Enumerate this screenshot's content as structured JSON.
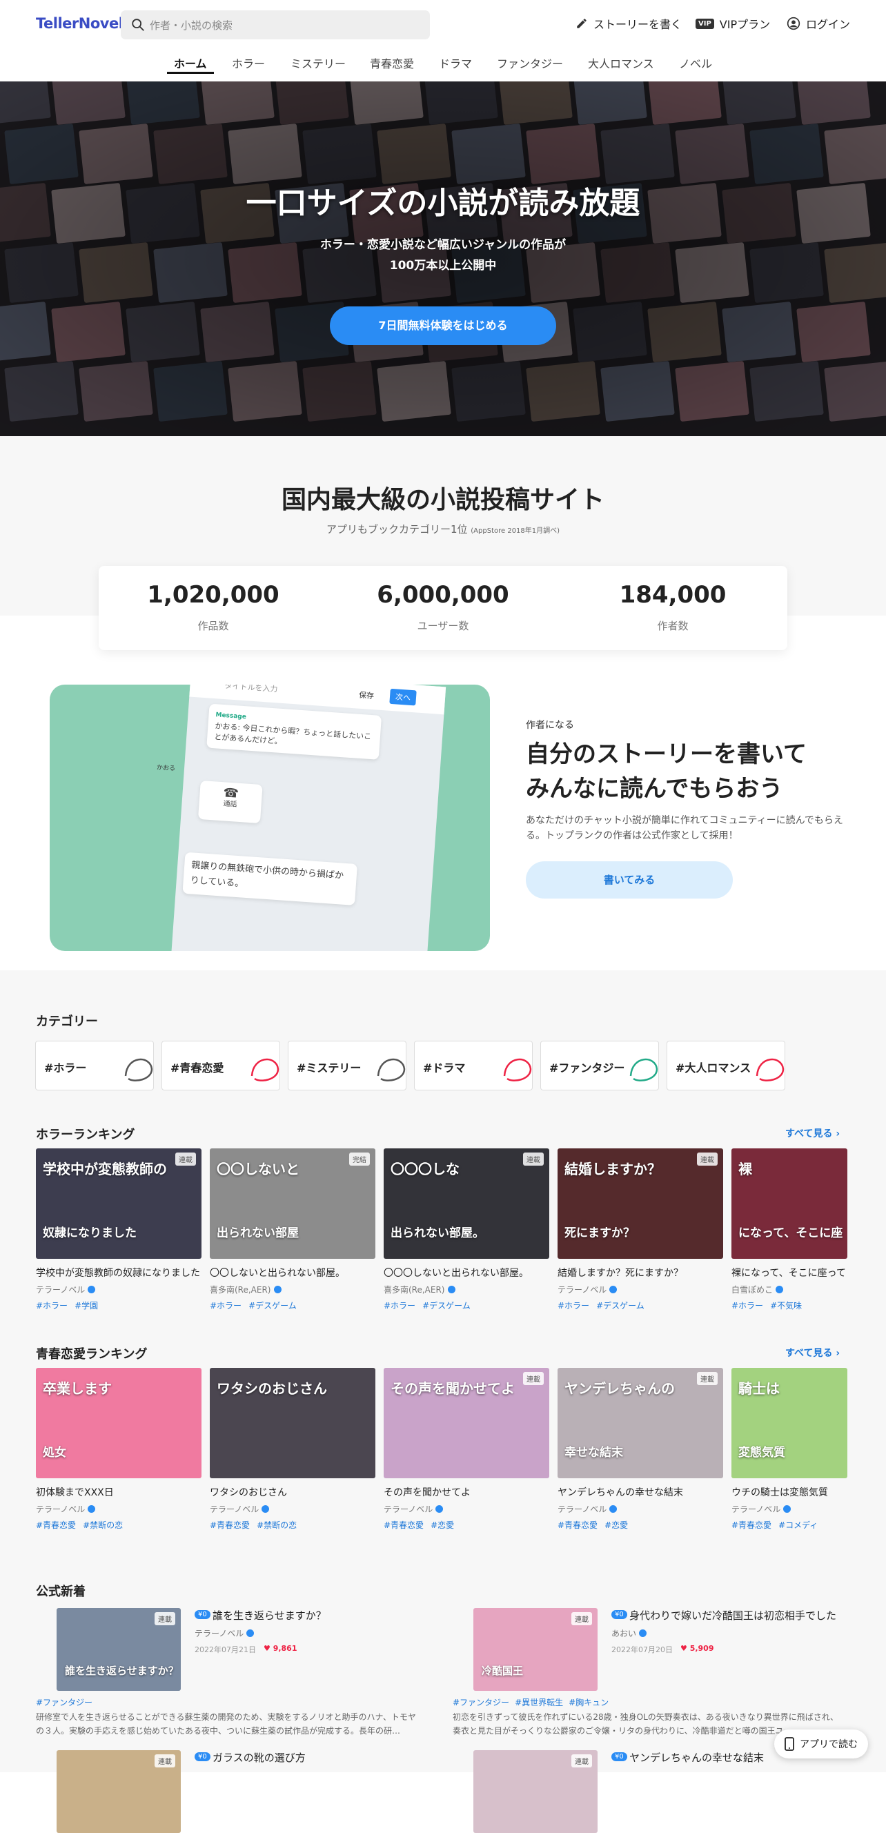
{
  "header": {
    "logo": "TellerNovel",
    "search_placeholder": "作者・小説の検索",
    "write_label": "ストーリーを書く",
    "vip_badge": "VIP",
    "vip_label": "VIPプラン",
    "login_label": "ログイン"
  },
  "nav": [
    "ホーム",
    "ホラー",
    "ミステリー",
    "青春恋愛",
    "ドラマ",
    "ファンタジー",
    "大人ロマンス",
    "ノベル"
  ],
  "hero": {
    "title": "一口サイズの小説が読み放題",
    "sub1": "ホラー・恋愛小説など幅広いジャンルの作品が",
    "sub2": "100万本以上公開中",
    "cta": "7日間無料体験をはじめる"
  },
  "stats": {
    "title": "国内最大級の小説投稿サイト",
    "subtitle": "アプリもブックカテゴリー1位",
    "subtitle_note": "(AppStore 2018年1月調べ)",
    "items": [
      {
        "num": "1,020,000",
        "label": "作品数"
      },
      {
        "num": "6,000,000",
        "label": "ユーザー数"
      },
      {
        "num": "184,000",
        "label": "作者数"
      }
    ]
  },
  "writer": {
    "tag": "作者になる",
    "heading1": "自分のストーリーを書いて",
    "heading2": "みんなに読んでもらおう",
    "desc": "あなただけのチャット小説が簡単に作れてコミュニティーに読んでもらえる。トップランクの作者は公式作家として採用！",
    "button": "書いてみる",
    "mock_title_ph": "タイトルを入力",
    "mock_save": "保存",
    "mock_next": "次へ",
    "mock_message_label": "Message",
    "mock_message": "かおる: 今日これから暇？ちょっと話したいことがあるんだけど。",
    "mock_name": "かおる",
    "mock_call": "通話",
    "mock_text": "親譲りの無鉄砲で小供の時から損ばかりしている。"
  },
  "categories": {
    "title": "カテゴリー",
    "items": [
      "#ホラー",
      "#青春恋愛",
      "#ミステリー",
      "#ドラマ",
      "#ファンタジー",
      "#大人ロマンス"
    ]
  },
  "horror_ranking": {
    "title": "ホラーランキング",
    "see_all": "すべて見る ›",
    "books": [
      {
        "title": "学校中が変態教師の奴隷になりました",
        "author": "テラーノベル",
        "tags": [
          "#ホラー",
          "#学園"
        ],
        "badge": "連載",
        "cover_text": "学校中が変態教師の",
        "cover_text2": "奴隷になりました"
      },
      {
        "title": "〇〇しないと出られない部屋。",
        "author": "喜多南(Re,AER)",
        "tags": [
          "#ホラー",
          "#デスゲーム"
        ],
        "badge": "完結",
        "cover_text": "〇〇しないと",
        "cover_text2": "出られない部屋"
      },
      {
        "title": "〇〇〇しないと出られない部屋。",
        "author": "喜多南(Re,AER)",
        "tags": [
          "#ホラー",
          "#デスゲーム"
        ],
        "badge": "連載",
        "cover_text": "〇〇〇しな",
        "cover_text2": "出られない部屋。"
      },
      {
        "title": "結婚しますか？死にますか？",
        "author": "テラーノベル",
        "tags": [
          "#ホラー",
          "#デスゲーム"
        ],
        "badge": "連載",
        "cover_text": "結婚しますか？",
        "cover_text2": "死にますか？"
      },
      {
        "title": "裸になって、そこに座って",
        "author": "白雪ぽめこ",
        "tags": [
          "#ホラー",
          "#不気味"
        ],
        "badge": "",
        "cover_text": "裸",
        "cover_text2": "になって、そこに座"
      }
    ]
  },
  "romance_ranking": {
    "title": "青春恋愛ランキング",
    "see_all": "すべて見る ›",
    "books": [
      {
        "title": "初体験までXXX日",
        "author": "テラーノベル",
        "tags": [
          "#青春恋愛",
          "#禁断の恋"
        ],
        "badge": "",
        "cover_text": "卒業します",
        "cover_text2": "処女"
      },
      {
        "title": "ワタシのおじさん",
        "author": "テラーノベル",
        "tags": [
          "#青春恋愛",
          "#禁断の恋"
        ],
        "badge": "",
        "cover_text": "ワタシのおじさん",
        "cover_text2": ""
      },
      {
        "title": "その声を聞かせてよ",
        "author": "テラーノベル",
        "tags": [
          "#青春恋愛",
          "#恋愛"
        ],
        "badge": "連載",
        "cover_text": "その声を聞かせてよ",
        "cover_text2": ""
      },
      {
        "title": "ヤンデレちゃんの幸せな結末",
        "author": "テラーノベル",
        "tags": [
          "#青春恋愛",
          "#恋愛"
        ],
        "badge": "連載",
        "cover_text": "ヤンデレちゃんの",
        "cover_text2": "幸せな結末"
      },
      {
        "title": "ウチの騎士は変態気質",
        "author": "テラーノベル",
        "tags": [
          "#青春恋愛",
          "#コメディ"
        ],
        "badge": "",
        "cover_text": "騎士は",
        "cover_text2": "変態気質"
      }
    ]
  },
  "official_news": {
    "title": "公式新着",
    "items": [
      {
        "badge": "¥0",
        "title": "誰を生き返らせますか？",
        "author": "テラーノベル",
        "date": "2022年07月21日",
        "likes": "♥ 9,861",
        "tags": [
          "#ファンタジー"
        ],
        "desc": "研修室で人を生き返らせることができる蘇生薬の開発のため、実験をするノリオと助手のハナ、トモヤの３人。実験の手応えを感じ始めていたある夜中、ついに蘇生薬の試作品が完成する。長年の研…",
        "cover_text": "誰を生き返らせますか？",
        "cover_badge": "連載"
      },
      {
        "badge": "¥0",
        "title": "身代わりで嫁いだ冷酷国王は初恋相手でした",
        "author": "あおい",
        "date": "2022年07月20日",
        "likes": "♥ 5,909",
        "tags": [
          "#ファンタジー",
          "#異世界転生",
          "#胸キュン"
        ],
        "desc": "初恋を引きずって彼氏を作れずにいる28歳・独身OLの矢野奏衣は、ある夜いきなり異世界に飛ばされ、奏衣と見た目がそっくりな公爵家のご令嬢・リタの身代わりに、冷酷非道だと噂の国王ユー…",
        "cover_text": "冷酷国王",
        "cover_badge": "連載"
      },
      {
        "badge": "¥0",
        "title": "ガラスの靴の選び方",
        "cover_badge": "連載"
      },
      {
        "badge": "¥0",
        "title": "ヤンデレちゃんの幸せな結末",
        "cover_badge": "連載"
      }
    ]
  },
  "app_button": "アプリで読む",
  "colors": {
    "accent": "#2a8cf4",
    "logo": "#3a4cc4",
    "tag": "#1e78d8",
    "like": "#e24444"
  }
}
